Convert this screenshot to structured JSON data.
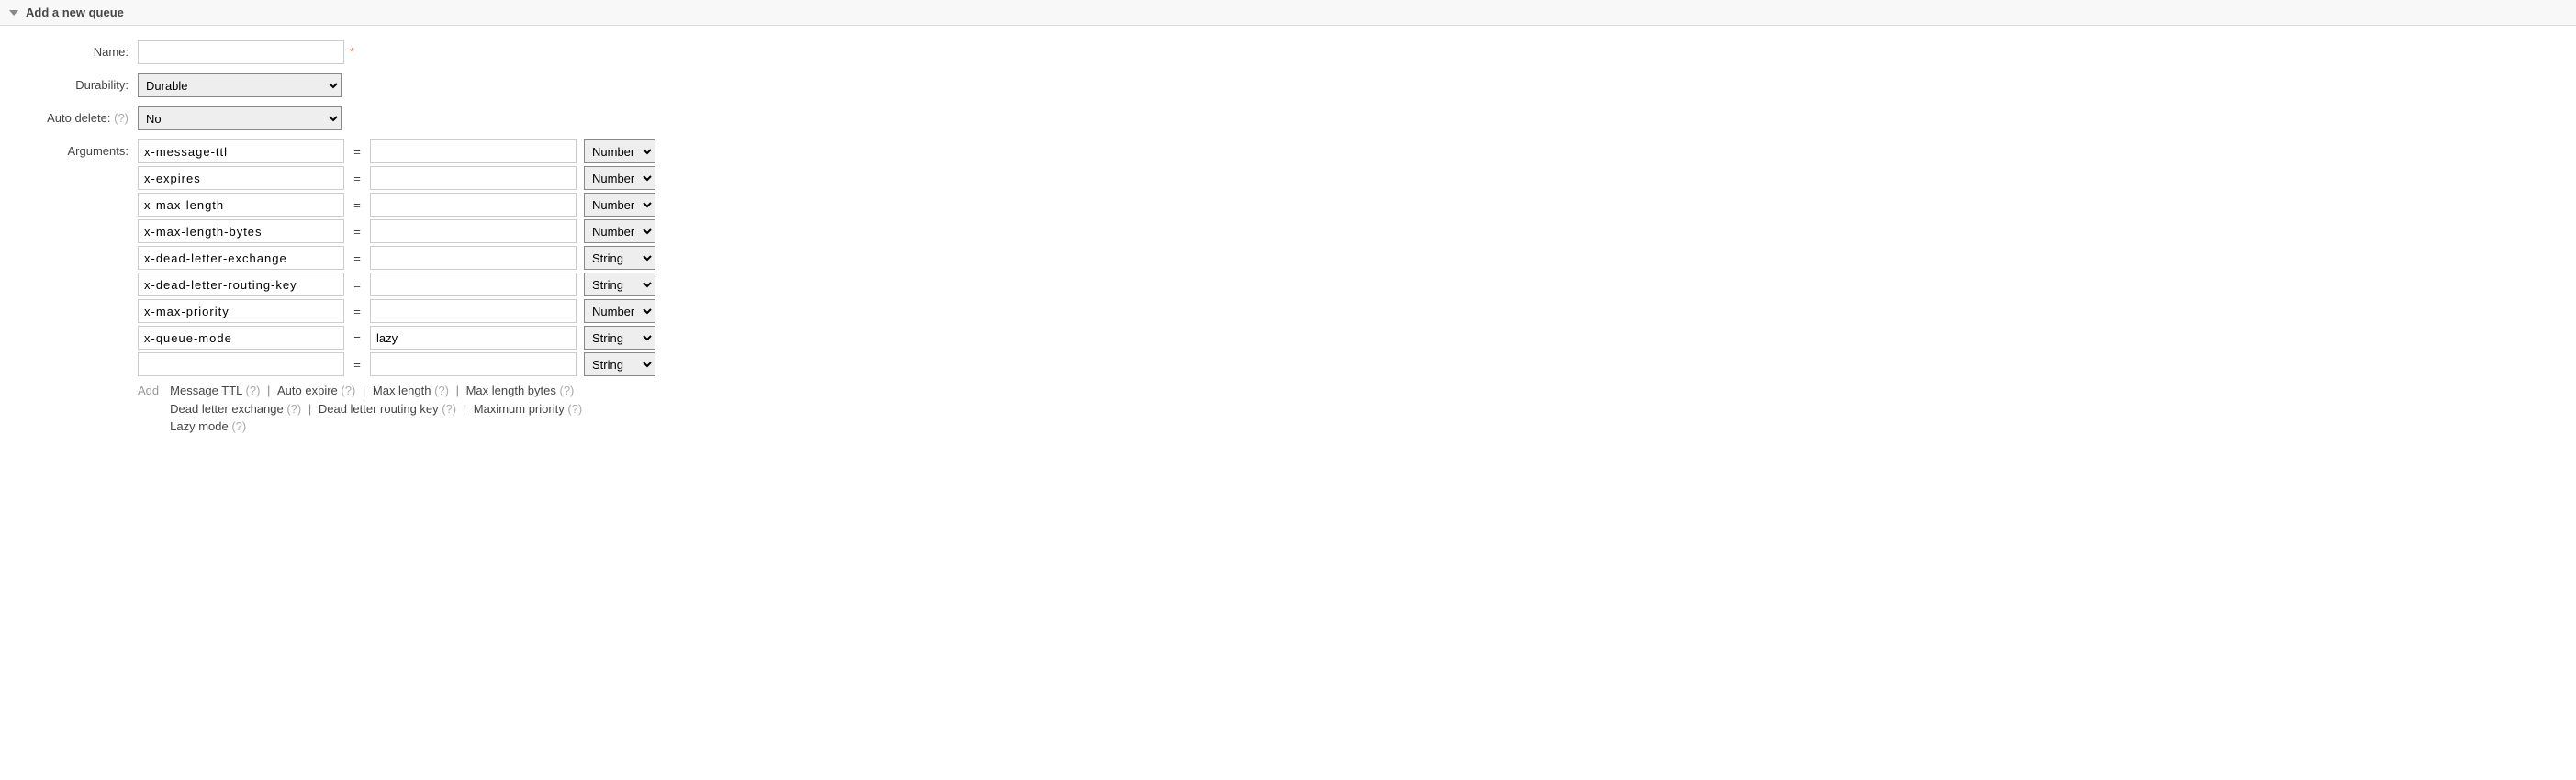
{
  "section": {
    "title": "Add a new queue"
  },
  "form": {
    "name_label": "Name:",
    "name_value": "",
    "required_mark": "*",
    "durability_label": "Durability:",
    "durability_value": "Durable",
    "auto_delete_label": "Auto delete:",
    "help_q": "(?)",
    "auto_delete_value": "No",
    "arguments_label": "Arguments:",
    "eq": "="
  },
  "args": [
    {
      "key": "x-message-ttl",
      "val": "",
      "type": "Number"
    },
    {
      "key": "x-expires",
      "val": "",
      "type": "Number"
    },
    {
      "key": "x-max-length",
      "val": "",
      "type": "Number"
    },
    {
      "key": "x-max-length-bytes",
      "val": "",
      "type": "Number"
    },
    {
      "key": "x-dead-letter-exchange",
      "val": "",
      "type": "String"
    },
    {
      "key": "x-dead-letter-routing-key",
      "val": "",
      "type": "String"
    },
    {
      "key": "x-max-priority",
      "val": "",
      "type": "Number"
    },
    {
      "key": "x-queue-mode",
      "val": "lazy",
      "type": "String"
    },
    {
      "key": "",
      "val": "",
      "type": "String"
    }
  ],
  "types": {
    "number": "Number",
    "string": "String"
  },
  "hints": {
    "add_label": "Add",
    "line1": [
      "Message TTL",
      "Auto expire",
      "Max length",
      "Max length bytes"
    ],
    "line2": [
      "Dead letter exchange",
      "Dead letter routing key",
      "Maximum priority"
    ],
    "line3": [
      "Lazy mode"
    ],
    "sep": " | "
  }
}
